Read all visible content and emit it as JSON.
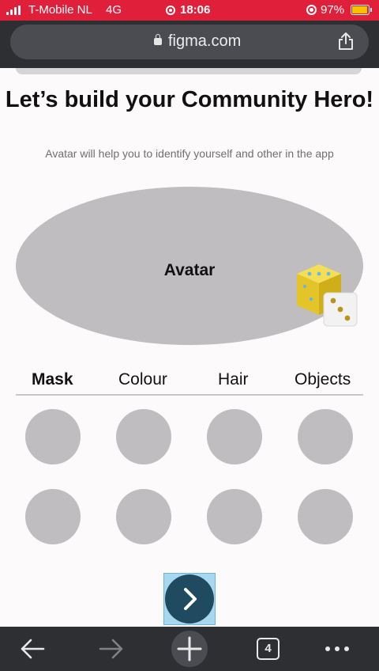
{
  "status_bar": {
    "carrier": "T-Mobile NL",
    "network": "4G",
    "time": "18:06",
    "battery": "97%",
    "battery_level": 0.97
  },
  "browser": {
    "url": "figma.com",
    "tab_count": "4",
    "icons": [
      "lock-icon",
      "share-icon",
      "back-arrow-icon",
      "forward-arrow-icon",
      "plus-icon",
      "more-dots-icon"
    ]
  },
  "page": {
    "title": "Let’s build your Community Hero!",
    "subtitle": "Avatar will help you to identify yourself and other in the app",
    "avatar_label": "Avatar",
    "tabs": [
      {
        "label": "Mask",
        "active": true
      },
      {
        "label": "Colour",
        "active": false
      },
      {
        "label": "Hair",
        "active": false
      },
      {
        "label": "Objects",
        "active": false
      }
    ],
    "option_count": 8,
    "next_icon": "chevron-right-icon",
    "randomize_icon": "dice-icon"
  },
  "colors": {
    "status_bar": "#e0203a",
    "browser_chrome": "#2d2f33",
    "placeholder": "#bfbdbf",
    "next_button": "#1f4a5f",
    "selection": "#a8d8f0"
  }
}
